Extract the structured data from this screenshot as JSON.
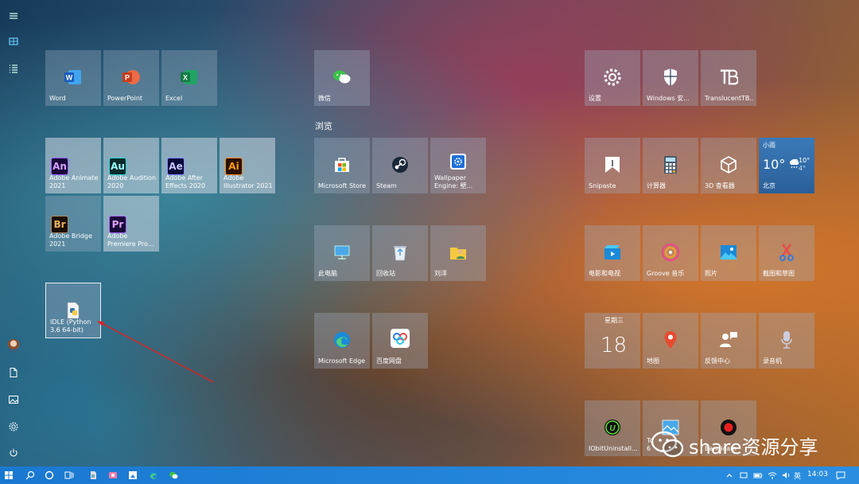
{
  "groups": {
    "browse_title": "浏览"
  },
  "tiles": {
    "word": "Word",
    "powerpoint": "PowerPoint",
    "excel": "Excel",
    "animate": "Adobe Animate 2021",
    "audition": "Adobe Audition 2020",
    "after_effects": "Adobe After Effects 2020",
    "illustrator": "Adobe Illustrator 2021",
    "bridge": "Adobe Bridge 2021",
    "premiere": "Adobe Premiere Pro...",
    "idle": "IDLE (Python 3.6 64-bit)",
    "wechat": "微信",
    "ms_store": "Microsoft Store",
    "steam": "Steam",
    "wallpaper": "Wallpaper Engine: 壁...",
    "this_pc": "此电脑",
    "recycle": "回收站",
    "user": "刘洋",
    "edge": "Microsoft Edge",
    "baidu": "百度网盘",
    "settings": "设置",
    "security": "Windows 安...",
    "translucent": "TranslucentTB...",
    "snipaste": "Snipaste",
    "calculator": "计算器",
    "viewer3d": "3D 查看器",
    "movies": "电影和电视",
    "groove": "Groove 音乐",
    "photos": "照片",
    "snip": "截图和草图",
    "maps": "地图",
    "feedback": "反馈中心",
    "recorder": "录音机",
    "iobit": "IObitUninstall...",
    "to_partial": "To",
    "to_partial2": "6",
    "bandicam": "Bandicam"
  },
  "adobe_codes": {
    "an": "An",
    "au": "Au",
    "ae": "Ae",
    "ai": "Ai",
    "br": "Br",
    "pr": "Pr"
  },
  "weather": {
    "condition": "小雨",
    "temp": "10°",
    "high": "10°",
    "low": "4°",
    "city": "北京"
  },
  "calendar": {
    "weekday": "星期三",
    "day": "18"
  },
  "tray": {
    "ime": "英",
    "time": "14:03"
  },
  "watermark": {
    "text": "share资源分享"
  },
  "colors": {
    "taskbar": "#1a78d0",
    "annotation_arrow": "#e02020"
  }
}
